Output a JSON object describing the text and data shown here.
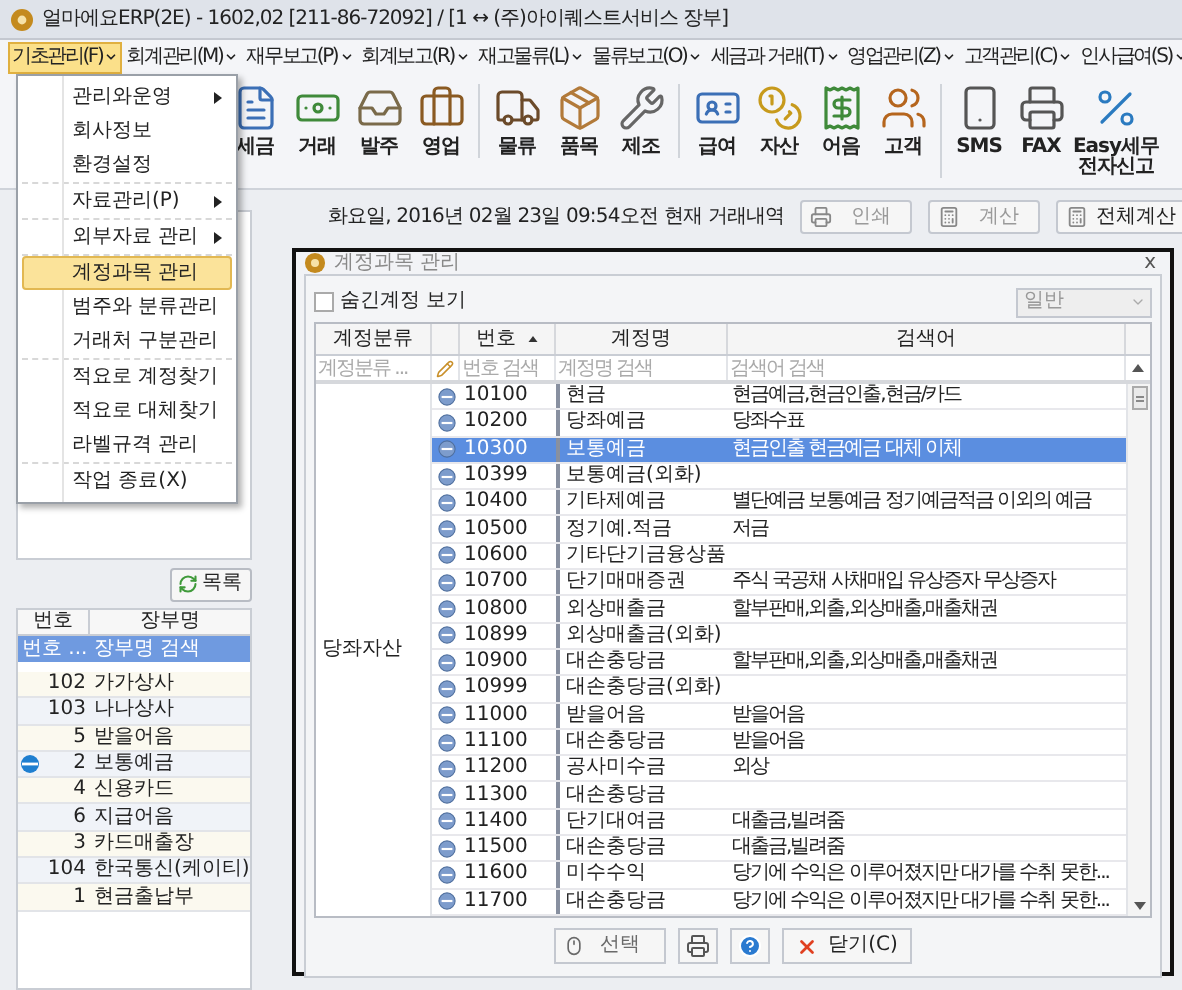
{
  "window": {
    "title": "얼마에요ERP(2E) - 1602,02 [211-86-72092] / [1 ↔ (주)아이퀘스트서비스 장부]"
  },
  "menu_bar": [
    {
      "label": "기초관리(F)",
      "selected": true
    },
    {
      "label": "회계관리(M)",
      "selected": false
    },
    {
      "label": "재무보고(P)",
      "selected": false
    },
    {
      "label": "회계보고(R)",
      "selected": false
    },
    {
      "label": "재고물류(L)",
      "selected": false
    },
    {
      "label": "물류보고(O)",
      "selected": false
    },
    {
      "label": "세금과 거래(T)",
      "selected": false
    },
    {
      "label": "영업관리(Z)",
      "selected": false
    },
    {
      "label": "고객관리(C)",
      "selected": false
    },
    {
      "label": "인사급여(S)",
      "selected": false
    }
  ],
  "toolbar": [
    [
      {
        "label": "세금"
      },
      {
        "label": "거래"
      },
      {
        "label": "발주"
      },
      {
        "label": "영업"
      }
    ],
    [
      {
        "label": "물류"
      },
      {
        "label": "품목"
      },
      {
        "label": "제조"
      }
    ],
    [
      {
        "label": "급여"
      },
      {
        "label": "자산"
      },
      {
        "label": "어음"
      },
      {
        "label": "고객"
      }
    ],
    [
      {
        "label": "SMS"
      },
      {
        "label": "FAX"
      },
      {
        "label": "Easy세무 전자신고"
      }
    ]
  ],
  "dropdown_menu": [
    [
      {
        "label": "관리와운영",
        "submenu": true,
        "selected": false
      },
      {
        "label": "회사정보",
        "submenu": false,
        "selected": false
      },
      {
        "label": "환경설정",
        "submenu": false,
        "selected": false
      }
    ],
    [
      {
        "label": "자료관리(P)",
        "submenu": true,
        "selected": false
      }
    ],
    [
      {
        "label": "외부자료 관리",
        "submenu": true,
        "selected": false
      }
    ],
    [
      {
        "label": "계정과목 관리",
        "submenu": false,
        "selected": true
      },
      {
        "label": "범주와 분류관리",
        "submenu": false,
        "selected": false
      },
      {
        "label": "거래처 구분관리",
        "submenu": false,
        "selected": false
      }
    ],
    [
      {
        "label": "적요로 계정찾기",
        "submenu": false,
        "selected": false
      },
      {
        "label": "적요로 대체찾기",
        "submenu": false,
        "selected": false
      },
      {
        "label": "라벨규격 관리",
        "submenu": false,
        "selected": false
      }
    ],
    [
      {
        "label": "작업 종료(X)",
        "submenu": false,
        "selected": false
      }
    ]
  ],
  "main": {
    "date_text": "화요일, 2016년 02월 23일 09:54오전 현재 거래내역",
    "buttons": [
      {
        "kind": "print",
        "label": "인쇄",
        "disabled": true
      },
      {
        "kind": "calc",
        "label": "계산",
        "disabled": true
      },
      {
        "kind": "calc",
        "label": "전체계산",
        "disabled": false
      }
    ],
    "list_button": "목록",
    "ledger_table": {
      "columns": [
        "번호",
        "장부명"
      ],
      "filters": [
        "번호 ...",
        "장부명 검색"
      ],
      "filter_selected": true,
      "rows": [
        {
          "number": "102",
          "name": "가가상사",
          "current": false
        },
        {
          "number": "103",
          "name": "나나상사",
          "current": false
        },
        {
          "number": "5",
          "name": "받을어음",
          "current": false
        },
        {
          "number": "2",
          "name": "보통예금",
          "current": true
        },
        {
          "number": "4",
          "name": "신용카드",
          "current": false
        },
        {
          "number": "6",
          "name": "지급어음",
          "current": false
        },
        {
          "number": "3",
          "name": "카드매출장",
          "current": false
        },
        {
          "number": "104",
          "name": "한국통신(케이티)",
          "current": false
        },
        {
          "number": "1",
          "name": "현금출납부",
          "current": false
        }
      ]
    }
  },
  "dialog": {
    "title": "계정과목 관리",
    "close": "ⅹ",
    "show_hidden": {
      "label": "숨긴계정 보기",
      "checked": false
    },
    "type_select": {
      "value": "일반",
      "disabled": true
    },
    "columns": [
      {
        "label": "계정분류",
        "sorted": false
      },
      {
        "label": "번호",
        "sorted": true
      },
      {
        "label": "계정명",
        "sorted": false
      },
      {
        "label": "검색어",
        "sorted": false
      }
    ],
    "filter_placeholders": [
      "계정분류 ...",
      "번호 검색",
      "계정명 검색",
      "검색어 검색"
    ],
    "category": "당좌자산",
    "rows": [
      {
        "number": "10100",
        "name": "현금",
        "keyword": "현금예금,현금인출,현금/카드",
        "selected": false
      },
      {
        "number": "10200",
        "name": "당좌예금",
        "keyword": "당좌수표",
        "selected": false
      },
      {
        "number": "10300",
        "name": "보통예금",
        "keyword": "현금인출 현금예금 대체 이체",
        "selected": true
      },
      {
        "number": "10399",
        "name": "보통예금(외화)",
        "selected": false
      },
      {
        "number": "10400",
        "name": "기타제예금",
        "keyword": "별단예금 보통예금 정기예금적금 이외의 예금",
        "selected": false
      },
      {
        "number": "10500",
        "name": "정기예.적금",
        "keyword": "저금",
        "selected": false
      },
      {
        "number": "10600",
        "name": "기타단기금융상품",
        "selected": false
      },
      {
        "number": "10700",
        "name": "단기매매증권",
        "keyword": "주식 국공채 사채매입 유상증자 무상증자",
        "selected": false
      },
      {
        "number": "10800",
        "name": "외상매출금",
        "keyword": "할부판매,외출,외상매출,매출채권",
        "selected": false
      },
      {
        "number": "10899",
        "name": "외상매출금(외화)",
        "selected": false
      },
      {
        "number": "10900",
        "name": "대손충당금",
        "keyword": "할부판매,외출,외상매출,매출채권",
        "selected": false
      },
      {
        "number": "10999",
        "name": "대손충당금(외화)",
        "selected": false
      },
      {
        "number": "11000",
        "name": "받을어음",
        "keyword": "받을어음",
        "selected": false
      },
      {
        "number": "11100",
        "name": "대손충당금",
        "keyword": "받을어음",
        "selected": false
      },
      {
        "number": "11200",
        "name": "공사미수금",
        "keyword": "외상",
        "selected": false
      },
      {
        "number": "11300",
        "name": "대손충당금",
        "selected": false
      },
      {
        "number": "11400",
        "name": "단기대여금",
        "keyword": "대출금,빌려줌",
        "selected": false
      },
      {
        "number": "11500",
        "name": "대손충당금",
        "keyword": "대출금,빌려줌",
        "selected": false
      },
      {
        "number": "11600",
        "name": "미수수익",
        "keyword": "당기에 수익은 이루어졌지만 대가를 수취 못한...",
        "selected": false
      },
      {
        "number": "11700",
        "name": "대손충당금",
        "keyword": "당기에 수익은 이루어졌지만 대가를 수취 못한...",
        "selected": false
      }
    ],
    "buttons": [
      {
        "kind": "select",
        "label": "선택",
        "disabled": true
      },
      {
        "kind": "print"
      },
      {
        "kind": "help"
      },
      {
        "kind": "close",
        "label": "닫기(C)",
        "disabled": false
      }
    ]
  }
}
